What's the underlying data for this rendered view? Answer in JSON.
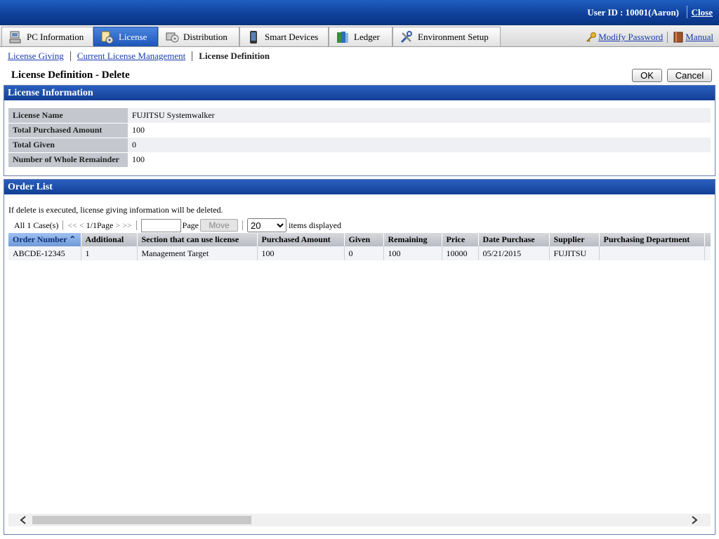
{
  "header": {
    "user_id": "User ID : 10001(Aaron)",
    "close": "Close"
  },
  "tabs": [
    {
      "label": "PC Information",
      "icon": "pc-icon"
    },
    {
      "label": "License",
      "icon": "license-icon"
    },
    {
      "label": "Distribution",
      "icon": "distribution-icon"
    },
    {
      "label": "Smart Devices",
      "icon": "smart-device-icon"
    },
    {
      "label": "Ledger",
      "icon": "ledger-icon"
    },
    {
      "label": "Environment Setup",
      "icon": "tools-icon"
    }
  ],
  "right_links": {
    "modify_password": "Modify Password",
    "manual": "Manual"
  },
  "breadcrumb": {
    "item1": "License Giving",
    "item2": "Current License Management",
    "current": "License Definition"
  },
  "page": {
    "title": "License Definition - Delete",
    "ok": "OK",
    "cancel": "Cancel"
  },
  "license_info": {
    "heading": "License Information",
    "rows": [
      {
        "label": "License Name",
        "value": "FUJITSU Systemwalker"
      },
      {
        "label": "Total Purchased Amount",
        "value": "100"
      },
      {
        "label": "Total Given",
        "value": "0"
      },
      {
        "label": "Number of Whole Remainder",
        "value": "100"
      }
    ]
  },
  "order_list": {
    "heading": "Order List",
    "notice": "If delete is executed, license giving information will be deleted.",
    "pager": {
      "count": "All 1 Case(s)",
      "first": "<<",
      "prev": "<",
      "page_info": "1/1Page",
      "next": ">",
      "last": ">>",
      "page_label": "Page",
      "move": "Move",
      "per_page": "20",
      "items_label": "items displayed"
    },
    "columns": [
      "Order Number",
      "Additional",
      "Section that can use license",
      "Purchased Amount",
      "Given",
      "Remaining",
      "Price",
      "Date Purchase",
      "Supplier",
      "Purchasing Department",
      ""
    ],
    "rows": [
      [
        "ABCDE-12345",
        "1",
        "Management Target",
        "100",
        "0",
        "100",
        "10000",
        "05/21/2015",
        "FUJITSU",
        "",
        ""
      ]
    ]
  }
}
